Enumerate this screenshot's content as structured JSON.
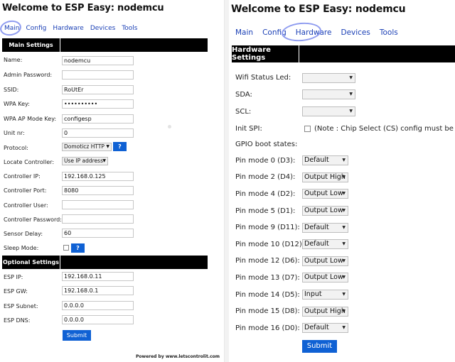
{
  "left": {
    "title": "Welcome to ESP Easy: nodemcu",
    "nav": [
      "Main",
      "Config",
      "Hardware",
      "Devices",
      "Tools"
    ],
    "main_header": "Main Settings",
    "rows": [
      {
        "label": "Name:",
        "value": "nodemcu"
      },
      {
        "label": "Admin Password:",
        "value": ""
      },
      {
        "label": "SSID:",
        "value": "RoUtEr"
      },
      {
        "label": "WPA Key:",
        "value": "••••••••••"
      },
      {
        "label": "WPA AP Mode Key:",
        "value": "configesp"
      },
      {
        "label": "Unit nr:",
        "value": "0"
      },
      {
        "label": "Protocol:",
        "value": "Domoticz HTTP"
      },
      {
        "label": "Locate Controller:",
        "value": "Use IP address"
      },
      {
        "label": "Controller IP:",
        "value": "192.168.0.125"
      },
      {
        "label": "Controller Port:",
        "value": "8080"
      },
      {
        "label": "Controller User:",
        "value": ""
      },
      {
        "label": "Controller Password:",
        "value": ""
      },
      {
        "label": "Sensor Delay:",
        "value": "60"
      },
      {
        "label": "Sleep Mode:",
        "value": ""
      }
    ],
    "help_label": "?",
    "optional_header": "Optional Settings",
    "optional_rows": [
      {
        "label": "ESP IP:",
        "value": "192.168.0.11"
      },
      {
        "label": "ESP GW:",
        "value": "192.168.0.1"
      },
      {
        "label": "ESP Subnet:",
        "value": "0.0.0.0"
      },
      {
        "label": "ESP DNS:",
        "value": "0.0.0.0"
      }
    ],
    "submit": "Submit",
    "powered": "Powered by www.letscontrolit.com"
  },
  "right": {
    "title": "Welcome to ESP Easy: nodemcu",
    "nav": [
      "Main",
      "Config",
      "Hardware",
      "Devices",
      "Tools"
    ],
    "header": "Hardware Settings",
    "wifi_led_label": "Wifi Status Led:",
    "sda_label": "SDA:",
    "scl_label": "SCL:",
    "init_spi_label": "Init SPI:",
    "init_spi_note": "(Note : Chip Select (CS) config must be done in",
    "gpio_label": "GPIO boot states:",
    "pins": [
      {
        "label": "Pin mode 0 (D3):",
        "value": "Default"
      },
      {
        "label": "Pin mode 2 (D4):",
        "value": "Output High"
      },
      {
        "label": "Pin mode 4 (D2):",
        "value": "Output Low"
      },
      {
        "label": "Pin mode 5 (D1):",
        "value": "Output Low"
      },
      {
        "label": "Pin mode 9 (D11):",
        "value": "Default"
      },
      {
        "label": "Pin mode 10 (D12):",
        "value": "Default"
      },
      {
        "label": "Pin mode 12 (D6):",
        "value": "Output Low"
      },
      {
        "label": "Pin mode 13 (D7):",
        "value": "Output Low"
      },
      {
        "label": "Pin mode 14 (D5):",
        "value": "Input"
      },
      {
        "label": "Pin mode 15 (D8):",
        "value": "Output High"
      },
      {
        "label": "Pin mode 16 (D0):",
        "value": "Default"
      }
    ],
    "submit": "Submit"
  },
  "colors": {
    "accent": "#0f61d4",
    "header_bg": "#000000",
    "link": "#1a3fb5",
    "annotation": "#8f9cf0"
  }
}
